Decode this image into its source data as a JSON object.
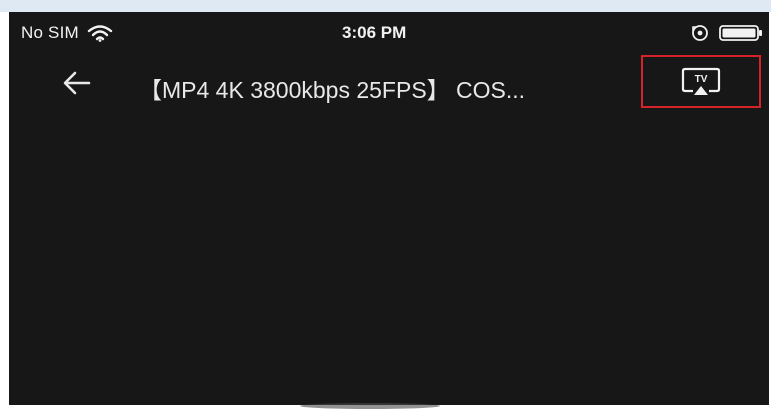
{
  "status_bar": {
    "carrier": "No SIM",
    "time": "3:06 PM",
    "icons": [
      "wifi-icon",
      "orientation-lock-icon",
      "battery-icon"
    ]
  },
  "nav_bar": {
    "back_icon": "arrow-left-icon",
    "title": "【MP4 4K 3800kbps 25FPS】 COS...",
    "cast_icon": "tv-cast-icon",
    "cast_icon_label": "TV"
  },
  "colors": {
    "screen_background": "#171717",
    "text": "#e8e8e8",
    "highlight_box": "#d6232a"
  }
}
